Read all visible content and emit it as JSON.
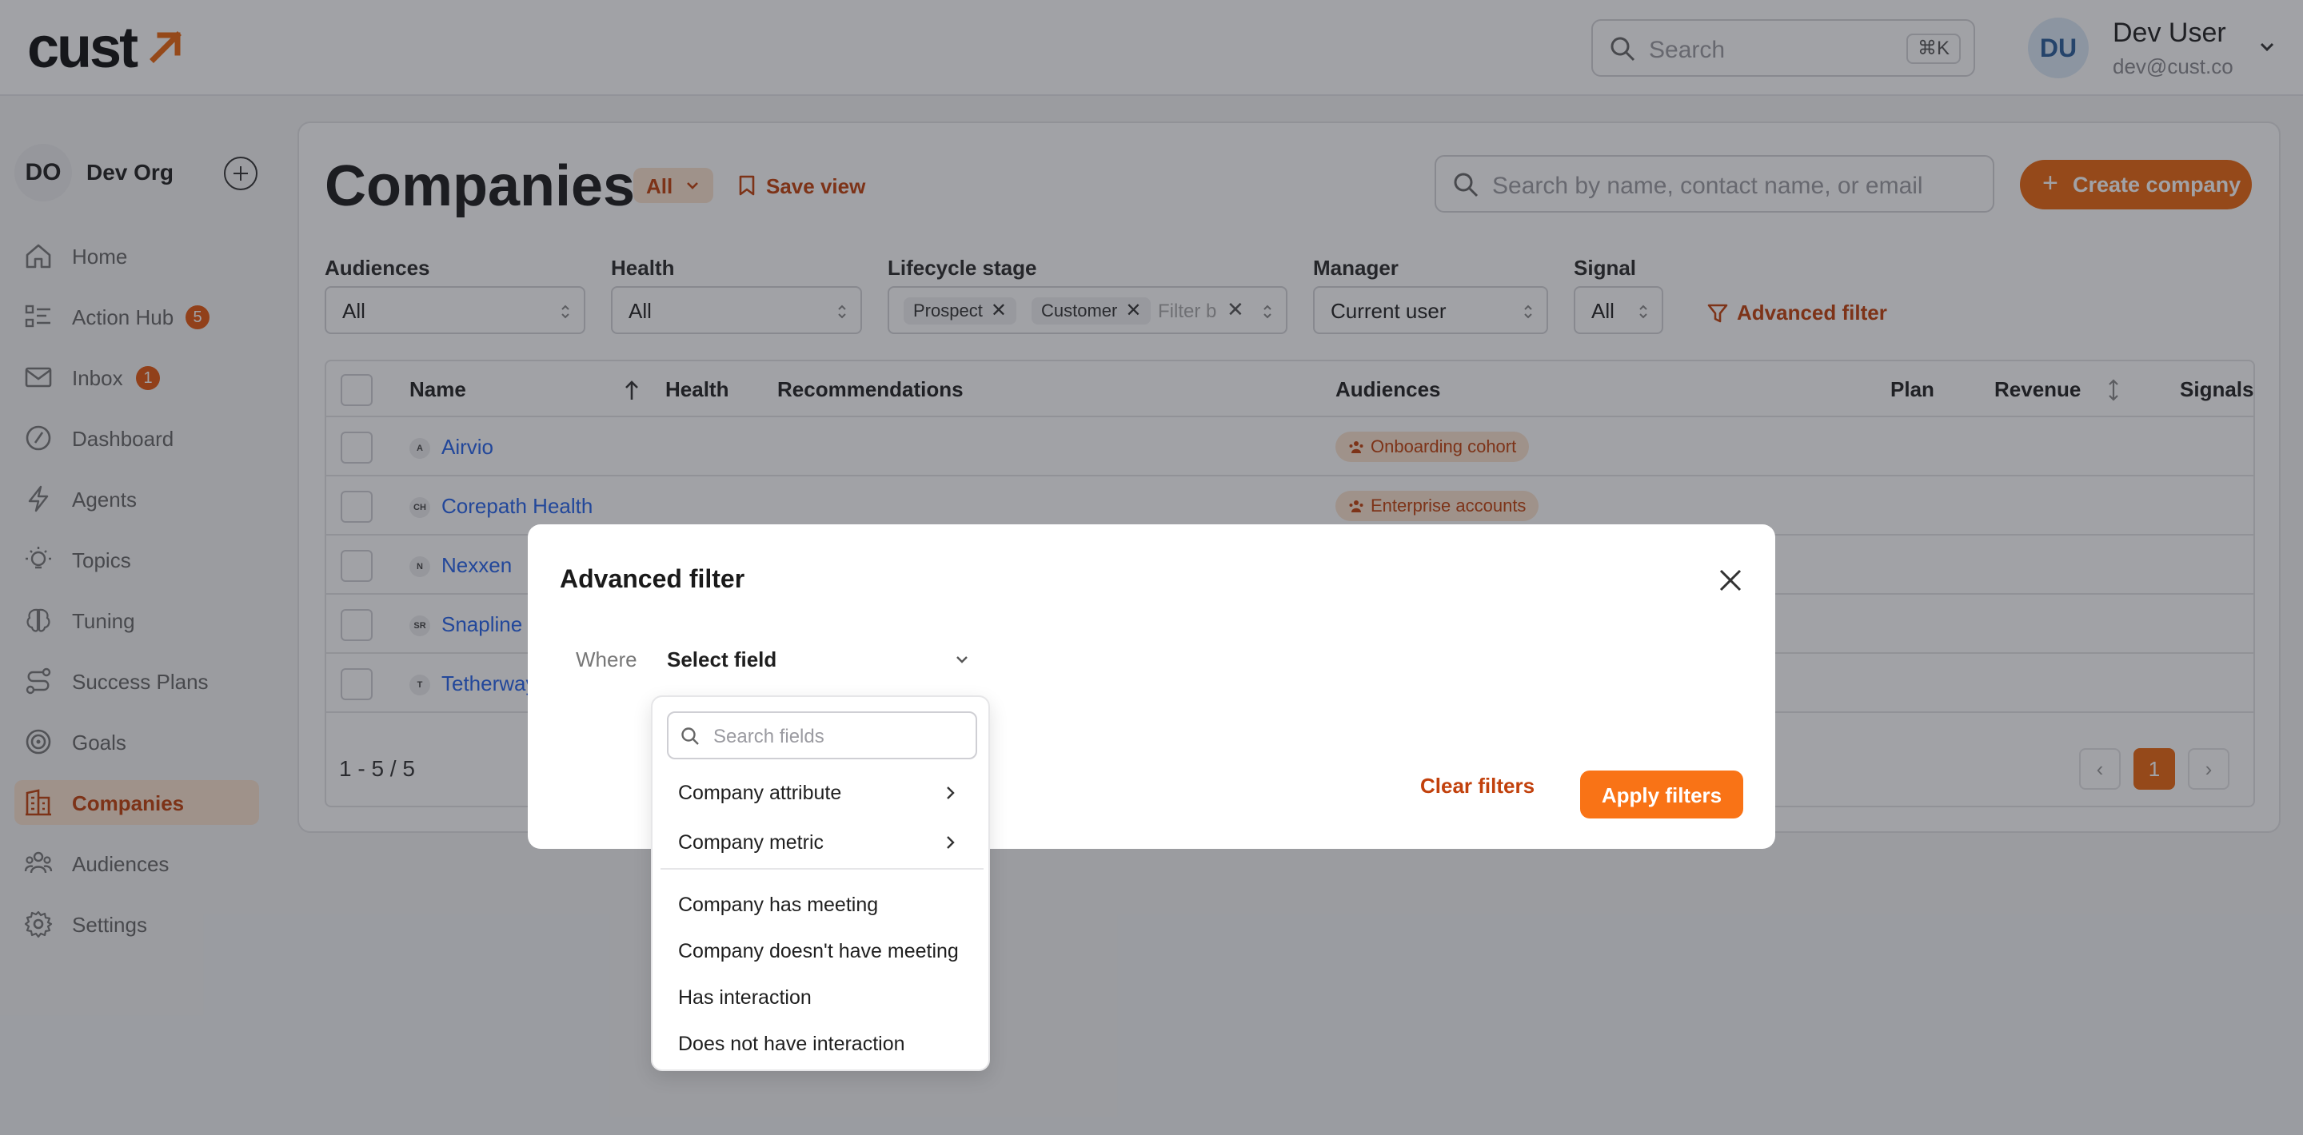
{
  "app": {
    "logo_text": "cust",
    "search_placeholder": "Search",
    "search_shortcut": "⌘K",
    "user": {
      "initials": "DU",
      "name": "Dev User",
      "email": "dev@cust.co"
    }
  },
  "sidebar": {
    "org": {
      "initials": "DO",
      "name": "Dev Org"
    },
    "items": [
      {
        "label": "Home",
        "icon": "home-icon"
      },
      {
        "label": "Action Hub",
        "icon": "list-icon",
        "badge": "5"
      },
      {
        "label": "Inbox",
        "icon": "mail-icon",
        "badge": "1"
      },
      {
        "label": "Dashboard",
        "icon": "gauge-icon"
      },
      {
        "label": "Agents",
        "icon": "bolt-icon"
      },
      {
        "label": "Topics",
        "icon": "lightbulb-icon"
      },
      {
        "label": "Tuning",
        "icon": "brain-icon"
      },
      {
        "label": "Success Plans",
        "icon": "route-icon"
      },
      {
        "label": "Goals",
        "icon": "target-icon"
      },
      {
        "label": "Companies",
        "icon": "building-icon",
        "active": true
      },
      {
        "label": "Audiences",
        "icon": "users-icon"
      },
      {
        "label": "Settings",
        "icon": "gear-icon"
      }
    ]
  },
  "page": {
    "title": "Companies",
    "view_selector": "All",
    "save_view": "Save view",
    "search_placeholder": "Search by name, contact name, or email",
    "create_button": "Create company",
    "filters": {
      "audiences": {
        "label": "Audiences",
        "value": "All"
      },
      "health": {
        "label": "Health",
        "value": "All"
      },
      "lifecycle": {
        "label": "Lifecycle stage",
        "chips": [
          "Prospect",
          "Customer"
        ],
        "placeholder": "Filter b"
      },
      "manager": {
        "label": "Manager",
        "value": "Current user"
      },
      "signal": {
        "label": "Signal",
        "value": "All"
      },
      "advanced_link": "Advanced filter"
    },
    "table": {
      "columns": [
        "Name",
        "Health",
        "Recommendations",
        "Audiences",
        "Plan",
        "Revenue",
        "Signals"
      ],
      "rows": [
        {
          "initials": "A",
          "name": "Airvio",
          "audience": "Onboarding cohort"
        },
        {
          "initials": "CH",
          "name": "Corepath Health",
          "audience": "Enterprise accounts"
        },
        {
          "initials": "N",
          "name": "Nexxen",
          "audience": ""
        },
        {
          "initials": "SR",
          "name": "Snapline R",
          "audience": ""
        },
        {
          "initials": "T",
          "name": "Tetherway",
          "audience": ""
        }
      ],
      "range": "1 - 5 / 5",
      "current_page": "1"
    }
  },
  "modal": {
    "title": "Advanced filter",
    "where_label": "Where",
    "field_select": "Select field",
    "clear_button": "Clear filters",
    "apply_button": "Apply filters"
  },
  "dropdown": {
    "search_placeholder": "Search fields",
    "submenus": [
      "Company attribute",
      "Company metric"
    ],
    "options": [
      "Company has meeting",
      "Company doesn't have meeting",
      "Has interaction",
      "Does not have interaction"
    ]
  },
  "colors": {
    "accent": "#ea670f",
    "accent_text": "#c2410c",
    "accent_soft": "#fbe3cf",
    "link": "#2563eb"
  }
}
